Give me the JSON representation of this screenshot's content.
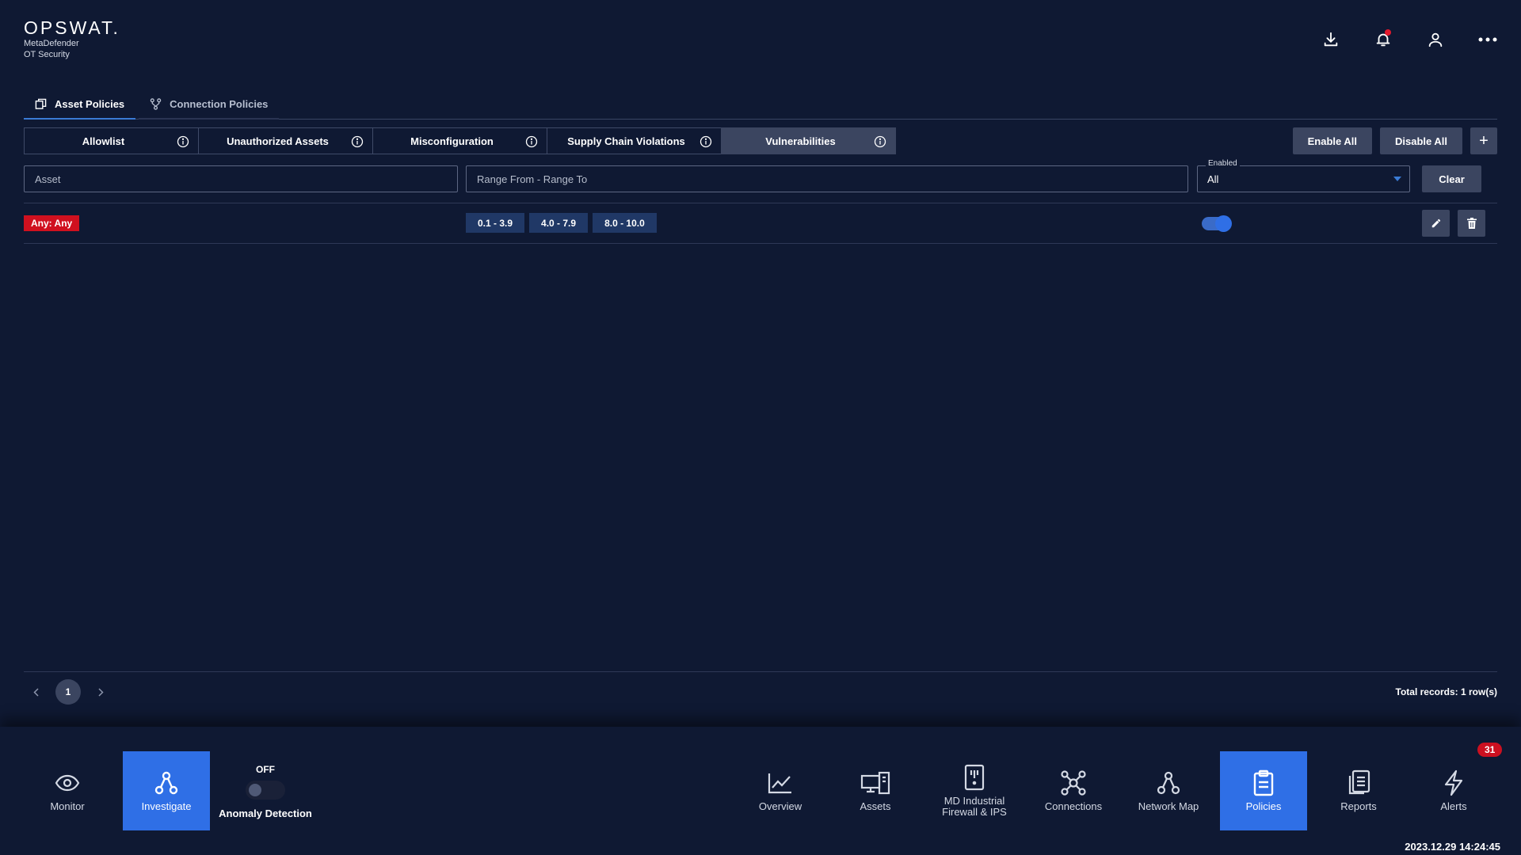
{
  "brand": {
    "logo": "OPSWAT.",
    "product_line1": "MetaDefender",
    "product_line2": "OT Security"
  },
  "header_icons": [
    "download-icon",
    "bell-icon",
    "user-icon",
    "more-icon"
  ],
  "main_tabs": [
    {
      "label": "Asset Policies",
      "icon": "asset-policies-icon",
      "active": true
    },
    {
      "label": "Connection Policies",
      "icon": "connection-policies-icon",
      "active": false
    }
  ],
  "sub_tabs": [
    {
      "label": "Allowlist",
      "active": false
    },
    {
      "label": "Unauthorized Assets",
      "active": false
    },
    {
      "label": "Misconfiguration",
      "active": false
    },
    {
      "label": "Supply Chain Violations",
      "active": false
    },
    {
      "label": "Vulnerabilities",
      "active": true
    }
  ],
  "actions": {
    "enable_all": "Enable All",
    "disable_all": "Disable All",
    "add": "+"
  },
  "filters": {
    "asset_placeholder": "Asset",
    "range_placeholder": "Range From - Range To",
    "enabled_label": "Enabled",
    "enabled_value": "All",
    "clear": "Clear"
  },
  "rows": [
    {
      "asset": "Any: Any",
      "ranges": [
        "0.1 - 3.9",
        "4.0 - 7.9",
        "8.0 - 10.0"
      ],
      "enabled": true
    }
  ],
  "pagination": {
    "current_page": "1",
    "total": "Total records: 1 row(s)"
  },
  "bottom_nav": {
    "left": [
      {
        "label": "Monitor",
        "icon": "eye-icon",
        "active": false
      },
      {
        "label": "Investigate",
        "icon": "investigate-icon",
        "active": true
      }
    ],
    "anomaly": {
      "state": "OFF",
      "label": "Anomaly Detection"
    },
    "right": [
      {
        "label": "Overview",
        "icon": "chart-line-icon",
        "active": false
      },
      {
        "label": "Assets",
        "icon": "assets-icon",
        "active": false
      },
      {
        "label": "MD Industrial Firewall & IPS",
        "icon": "firewall-icon",
        "active": false
      },
      {
        "label": "Connections",
        "icon": "connections-icon",
        "active": false
      },
      {
        "label": "Network Map",
        "icon": "network-map-icon",
        "active": false
      },
      {
        "label": "Policies",
        "icon": "clipboard-icon",
        "active": true
      },
      {
        "label": "Reports",
        "icon": "reports-icon",
        "active": false
      },
      {
        "label": "Alerts",
        "icon": "lightning-icon",
        "active": false
      }
    ],
    "alerts_badge": "31"
  },
  "timestamp": "2023.12.29 14:24:45",
  "colors": {
    "background": "#0f1933",
    "accent": "#2f6fe6",
    "panel": "#3b4560",
    "danger": "#d0101f",
    "chip": "#203866"
  }
}
